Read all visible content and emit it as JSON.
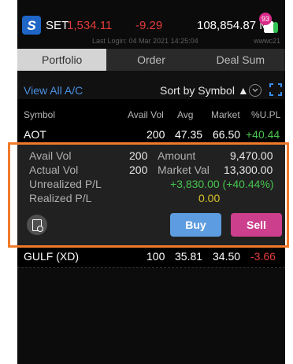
{
  "header": {
    "logo_icon": "s-logo-icon",
    "index_name": "SET",
    "index_value": "1,534.11",
    "index_change": "-9.29",
    "volume": "108,854.87 M",
    "notification_count": "93",
    "last_login": "Last Login: 04 Mar 2021 14:25:04",
    "user_code": "wwwc21"
  },
  "tabs": [
    {
      "label": "Portfolio",
      "active": true
    },
    {
      "label": "Order",
      "active": false
    },
    {
      "label": "Deal Sum",
      "active": false
    }
  ],
  "toolbar": {
    "view_all": "View All A/C",
    "sort_label": "Sort by Symbol ▲"
  },
  "columns": [
    "Symbol",
    "Avail Vol",
    "Avg",
    "Market",
    "%U.PL"
  ],
  "rows": [
    {
      "symbol": "AOT",
      "avail_vol": "200",
      "avg": "47.35",
      "market": "66.50",
      "upl": "+40.44"
    },
    {
      "symbol": "GULF (XD)",
      "avail_vol": "100",
      "avg": "35.81",
      "market": "34.50",
      "upl": "-3.66"
    }
  ],
  "detail": {
    "avail_vol_label": "Avail Vol",
    "avail_vol": "200",
    "amount_label": "Amount",
    "amount": "9,470.00",
    "actual_vol_label": "Actual Vol",
    "actual_vol": "200",
    "market_val_label": "Market Val",
    "market_val": "13,300.00",
    "unrealized_label": "Unrealized P/L",
    "unrealized": "+3,830.00 (+40.44%)",
    "realized_label": "Realized P/L",
    "realized": "0.00",
    "buy_label": "Buy",
    "sell_label": "Sell"
  },
  "colors": {
    "accent_highlight": "#f07a2a",
    "up": "#47c54e",
    "down": "#e23b3b",
    "buy": "#5d9ce0",
    "sell": "#cc3f8d"
  }
}
